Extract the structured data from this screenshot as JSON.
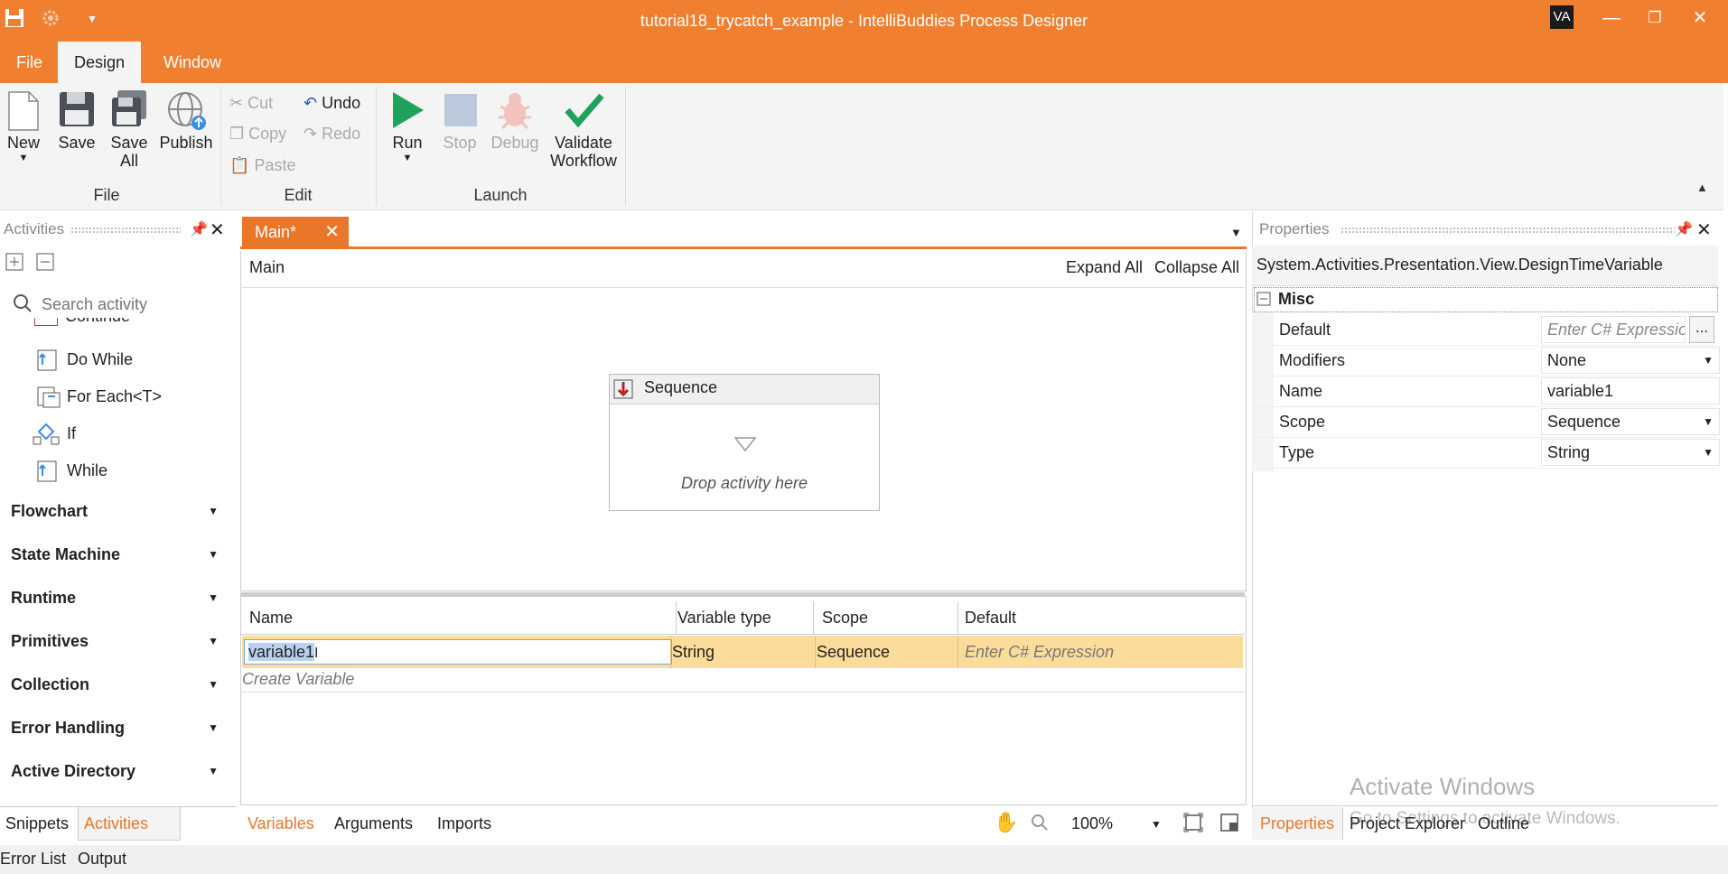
{
  "window": {
    "title": "tutorial18_trycatch_example - IntelliBuddies Process Designer",
    "user_initials": "VA"
  },
  "menu": [
    "File",
    "Design",
    "Window"
  ],
  "ribbon": {
    "file_group": {
      "label": "File",
      "new": "New",
      "save": "Save",
      "save_all_1": "Save",
      "save_all_2": "All",
      "publish": "Publish"
    },
    "edit_group": {
      "label": "Edit",
      "cut": "Cut",
      "copy": "Copy",
      "paste": "Paste",
      "undo": "Undo",
      "redo": "Redo"
    },
    "launch_group": {
      "label": "Launch",
      "run": "Run",
      "stop": "Stop",
      "debug": "Debug",
      "validate_1": "Validate",
      "validate_2": "Workflow"
    }
  },
  "activities": {
    "title": "Activities",
    "search_placeholder": "Search activity",
    "partial_item": "Continue",
    "items": [
      "Do While",
      "For Each<T>",
      "If",
      "While"
    ],
    "categories": [
      "Flowchart",
      "State Machine",
      "Runtime",
      "Primitives",
      "Collection",
      "Error Handling",
      "Active Directory"
    ],
    "bottom_tabs": [
      "Snippets",
      "Activities"
    ]
  },
  "document": {
    "tab": "Main*",
    "breadcrumb": "Main",
    "expand_all": "Expand All",
    "collapse_all": "Collapse All",
    "sequence_title": "Sequence",
    "drop_hint": "Drop activity here"
  },
  "variables": {
    "headers": [
      "Name",
      "Variable type",
      "Scope",
      "Default"
    ],
    "row": {
      "name": "variable1",
      "type": "String",
      "scope": "Sequence",
      "default_placeholder": "Enter C# Expression"
    },
    "create": "Create Variable",
    "tabs": [
      "Variables",
      "Arguments",
      "Imports"
    ],
    "zoom": "100%"
  },
  "properties": {
    "title": "Properties",
    "object": "System.Activities.Presentation.View.DesignTimeVariable",
    "section": "Misc",
    "rows": [
      {
        "label": "Default",
        "value": "Enter C# Expression"
      },
      {
        "label": "Modifiers",
        "value": "None"
      },
      {
        "label": "Name",
        "value": "variable1"
      },
      {
        "label": "Scope",
        "value": "Sequence"
      },
      {
        "label": "Type",
        "value": "String"
      }
    ],
    "bottom_tabs": [
      "Properties",
      "Project Explorer",
      "Outline"
    ]
  },
  "watermark": {
    "line1": "Activate Windows",
    "line2": "Go to Settings to activate Windows."
  },
  "status": [
    "Error List",
    "Output"
  ],
  "colors": {
    "accent": "#f08030",
    "selected_row": "#fcdc9a",
    "run_green": "#1fa35a"
  }
}
